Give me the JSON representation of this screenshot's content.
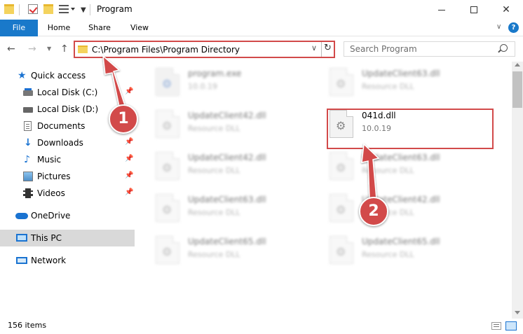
{
  "window": {
    "title": "Program"
  },
  "ribbon": {
    "tabs": [
      "File",
      "Home",
      "Share",
      "View"
    ],
    "help": "?"
  },
  "address": {
    "path": "C:\\Program Files\\Program Directory"
  },
  "search": {
    "placeholder": "Search Program"
  },
  "sidebar": {
    "items": [
      {
        "label": "Quick access",
        "icon": "star-icon"
      },
      {
        "label": "Local Disk (C:)",
        "icon": "drive-icon",
        "pinned": true
      },
      {
        "label": "Local Disk (D:)",
        "icon": "drive-icon"
      },
      {
        "label": "Documents",
        "icon": "documents-icon",
        "pinned": true
      },
      {
        "label": "Downloads",
        "icon": "download-icon",
        "pinned": true
      },
      {
        "label": "Music",
        "icon": "music-icon",
        "pinned": true
      },
      {
        "label": "Pictures",
        "icon": "pictures-icon",
        "pinned": true
      },
      {
        "label": "Videos",
        "icon": "videos-icon",
        "pinned": true
      },
      {
        "label": "OneDrive",
        "icon": "cloud-icon"
      },
      {
        "label": "This PC",
        "icon": "computer-icon",
        "selected": true
      },
      {
        "label": "Network",
        "icon": "network-icon"
      }
    ]
  },
  "files": [
    {
      "name": "program.exe",
      "sub": "10.0.19",
      "type": "exe",
      "blurred": true
    },
    {
      "name": "UpdateClient63.dll",
      "sub": "Resource DLL",
      "type": "dll",
      "blurred": true
    },
    {
      "name": "UpdateClient42.dll",
      "sub": "Resource DLL",
      "type": "dll",
      "blurred": true
    },
    {
      "name": "041d.dll",
      "sub": "10.0.19",
      "type": "dll",
      "blurred": false,
      "highlighted": true
    },
    {
      "name": "UpdateClient42.dll",
      "sub": "Resource DLL",
      "type": "dll",
      "blurred": true
    },
    {
      "name": "UpdateClient63.dll",
      "sub": "Resource DLL",
      "type": "dll",
      "blurred": true
    },
    {
      "name": "UpdateClient63.dll",
      "sub": "Resource DLL",
      "type": "dll",
      "blurred": true
    },
    {
      "name": "UpdateClient42.dll",
      "sub": "Resource DLL",
      "type": "dll",
      "blurred": true
    },
    {
      "name": "UpdateClient65.dll",
      "sub": "Resource DLL",
      "type": "dll",
      "blurred": true
    },
    {
      "name": "UpdateClient65.dll",
      "sub": "Resource DLL",
      "type": "dll",
      "blurred": true
    }
  ],
  "status": {
    "item_count": "156 items"
  },
  "annotations": {
    "step1": "1",
    "step2": "2",
    "color": "#d24a4a"
  }
}
